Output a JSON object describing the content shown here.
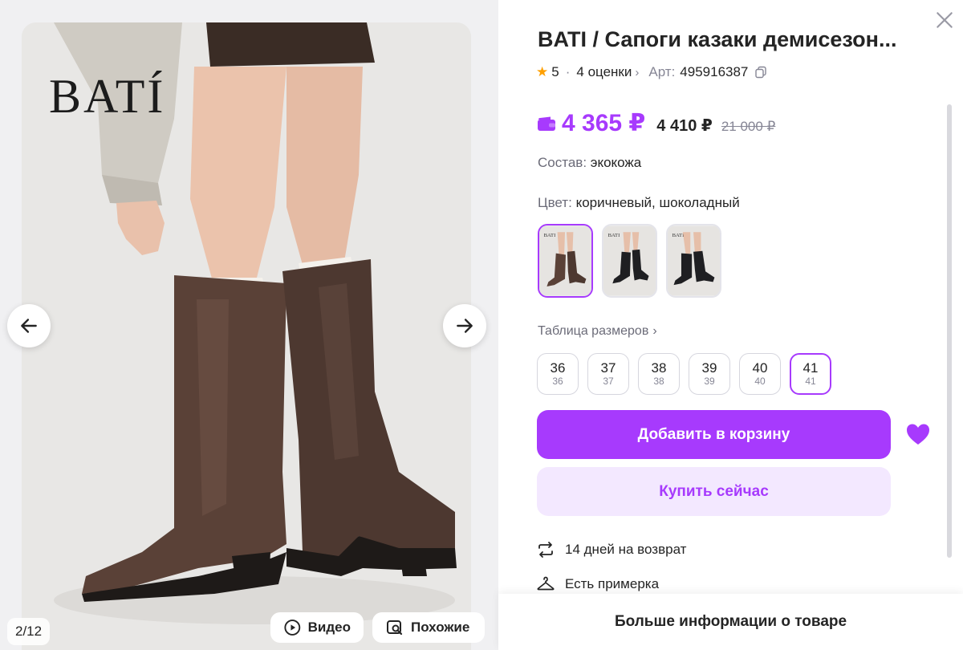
{
  "gallery": {
    "brand_logo": "BATÍ",
    "counter": "2/12",
    "video_label": "Видео",
    "similar_label": "Похожие"
  },
  "product": {
    "title": "BATI / Сапоги казаки демисезон...",
    "rating": "5",
    "reviews": "4 оценки",
    "article_label": "Арт:",
    "article_value": "495916387",
    "price_main": "4 365 ₽",
    "price_sub": "4 410 ₽",
    "price_old": "21 000 ₽",
    "composition_label": "Состав:",
    "composition_value": "экокожа",
    "color_label": "Цвет:",
    "color_value": "коричневый, шоколадный",
    "color_swatches": [
      "brown",
      "black",
      "black"
    ],
    "size_table_link": "Таблица размеров",
    "sizes": [
      {
        "ru": "36",
        "eu": "36"
      },
      {
        "ru": "37",
        "eu": "37"
      },
      {
        "ru": "38",
        "eu": "38"
      },
      {
        "ru": "39",
        "eu": "39"
      },
      {
        "ru": "40",
        "eu": "40"
      },
      {
        "ru": "41",
        "eu": "41"
      }
    ],
    "selected_size": "41",
    "add_to_cart": "Добавить в корзину",
    "buy_now": "Купить сейчас",
    "feature_return": "14 дней на возврат",
    "feature_fitting": "Есть примерка",
    "more_info": "Больше информации о товаре"
  },
  "colors": {
    "accent": "#a73afd",
    "accent_light": "#f3e8ff",
    "boot_brown": "#5a4137",
    "boot_black": "#1f1f22"
  }
}
